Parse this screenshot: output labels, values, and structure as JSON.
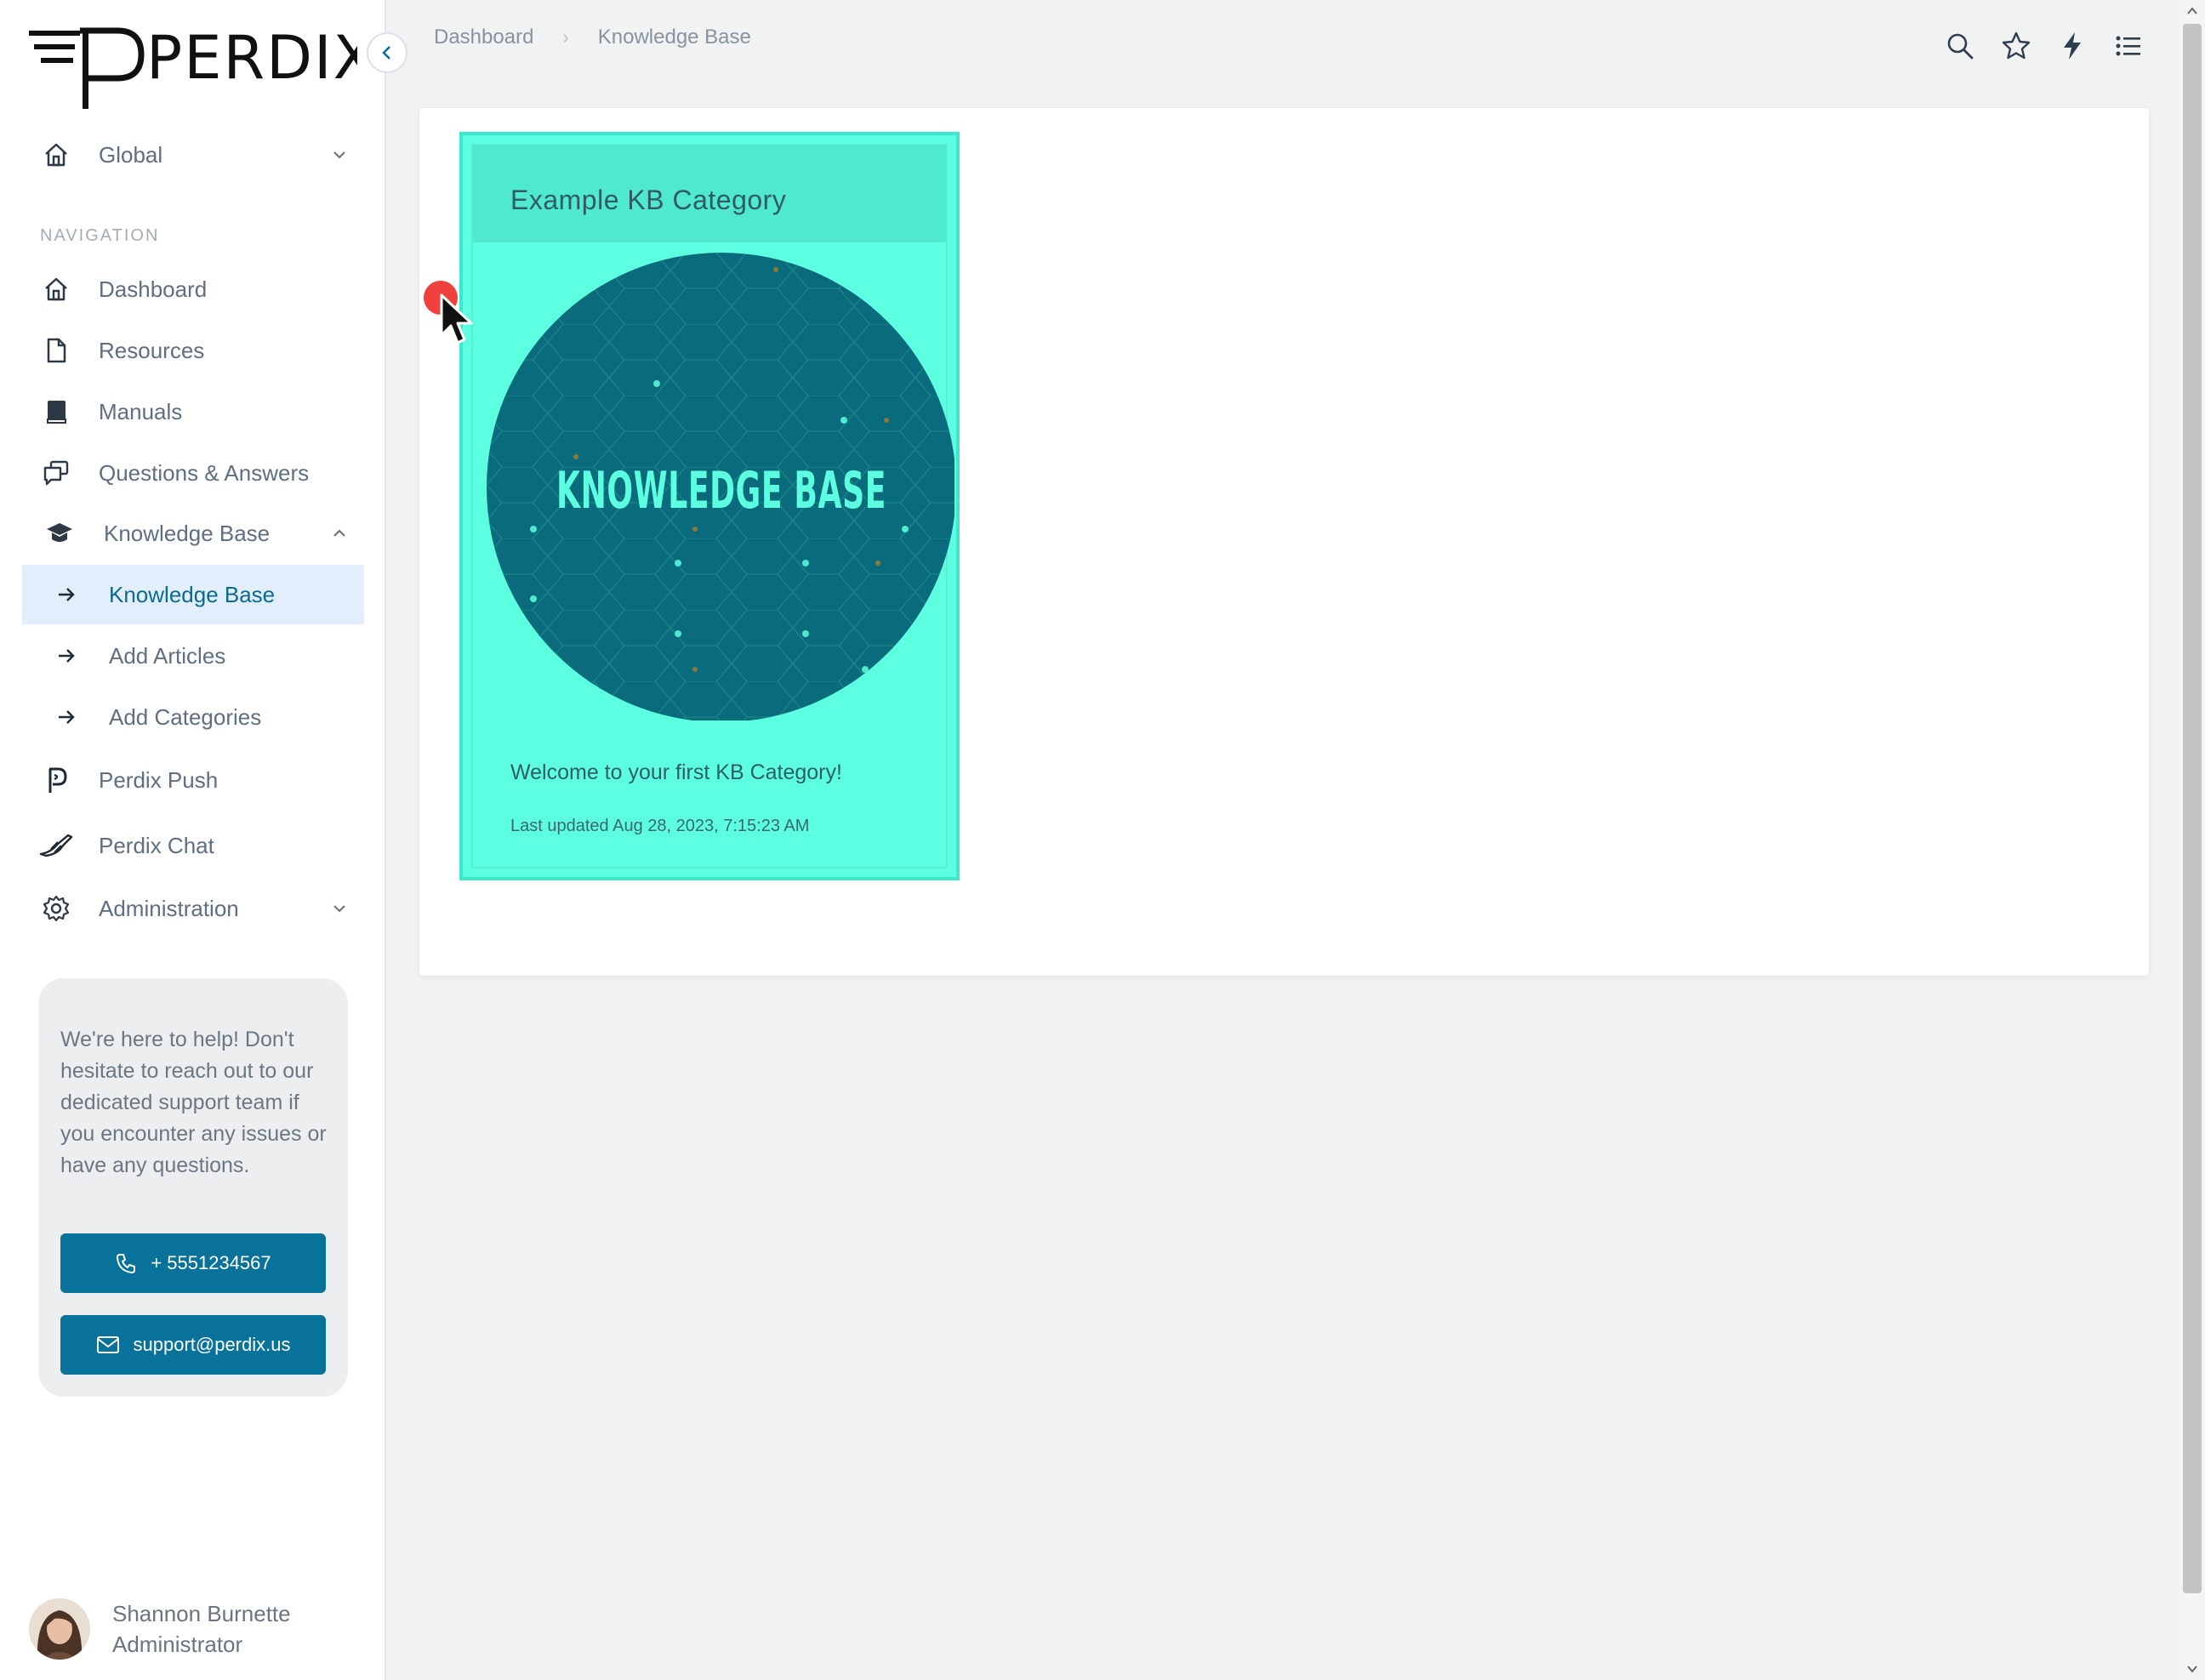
{
  "app": {
    "logo_text": "PERDIX"
  },
  "breadcrumb": {
    "items": [
      "Dashboard",
      "Knowledge Base"
    ],
    "separator": "›"
  },
  "sidebar": {
    "global_label": "Global",
    "section_label": "NAVIGATION",
    "items": [
      {
        "label": "Dashboard",
        "icon": "home-icon"
      },
      {
        "label": "Resources",
        "icon": "file-icon"
      },
      {
        "label": "Manuals",
        "icon": "book-icon"
      },
      {
        "label": "Questions & Answers",
        "icon": "chat-icon"
      },
      {
        "label": "Knowledge Base",
        "icon": "graduation-cap-icon",
        "expanded": true
      },
      {
        "label": "Perdix Push",
        "icon": "perdix-push-icon"
      },
      {
        "label": "Perdix Chat",
        "icon": "perdix-chat-icon"
      },
      {
        "label": "Administration",
        "icon": "gear-icon"
      }
    ],
    "kb_subitems": [
      {
        "label": "Knowledge Base",
        "active": true
      },
      {
        "label": "Add Articles",
        "active": false
      },
      {
        "label": "Add Categories",
        "active": false
      }
    ]
  },
  "help": {
    "text": "We're here to help! Don't hesitate to reach out to our dedicated support team if you encounter any issues or have any questions.",
    "phone": "+ 5551234567",
    "email": "support@perdix.us"
  },
  "user": {
    "name": "Shannon Burnette",
    "role": "Administrator"
  },
  "top_icons": [
    "search-icon",
    "star-icon",
    "lightning-icon",
    "list-icon"
  ],
  "kb_card": {
    "title": "Example KB Category",
    "image_text": "KNOWLEDGE BASE",
    "description": "Welcome to your first KB Category!",
    "updated": "Last updated Aug 28, 2023, 7:15:23 AM"
  },
  "colors": {
    "accent": "#08729a",
    "card_bg": "#5cffdf",
    "card_header": "#4fe9cf",
    "circle": "#0a6e7f",
    "active_item_bg": "#e2eefb"
  }
}
